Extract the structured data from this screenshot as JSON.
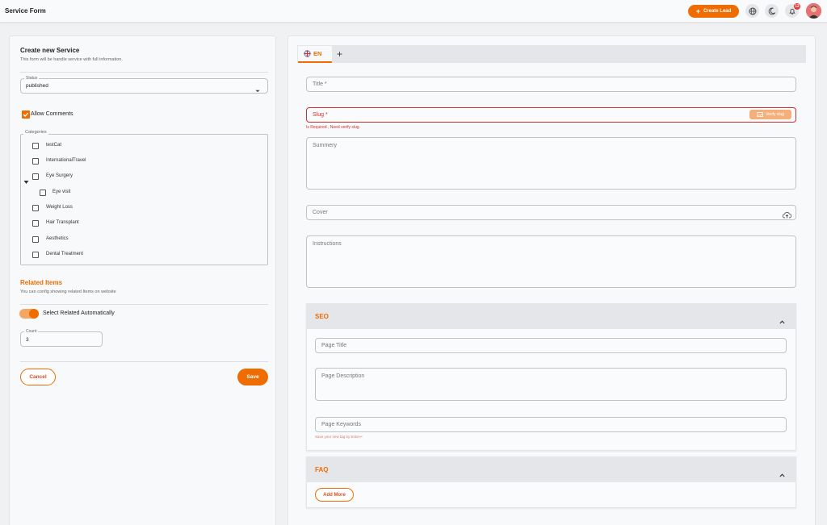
{
  "app": {
    "title": "Service Form"
  },
  "topbar": {
    "create_lead_label": "Create Lead",
    "notification_count": "12"
  },
  "left": {
    "title": "Create new Service",
    "subtitle": "This form will be handle service with full information.",
    "status": {
      "label": "Status",
      "value": "published"
    },
    "allow_comments_label": "Allow Comments",
    "categories_label": "Categories",
    "categories": [
      "testCat",
      "InternationalTravel",
      "Eye Surgery",
      "Eye visit",
      "Weight Loss",
      "Hair Transplant",
      "Aesthetics",
      "Dental Treatment"
    ],
    "related": {
      "title": "Related Items",
      "subtitle": "You can config showing related Items on website",
      "toggle_label": "Select Related Automatically",
      "count_label": "Count",
      "count_value": "3"
    },
    "cancel_label": "Cancel",
    "save_label": "Save"
  },
  "right": {
    "tab_label": "EN",
    "title_placeholder": "Title *",
    "slug_placeholder": "Slug *",
    "verify_label": "Verify slug",
    "slug_error": "Is Required , Need verify slug.",
    "summery_placeholder": "Summery",
    "cover_placeholder": "Cover",
    "instructions_placeholder": "Instructions",
    "seo": {
      "title": "SEO",
      "page_title_placeholder": "Page Title",
      "page_description_placeholder": "Page Description",
      "page_keywords_placeholder": "Page Keywords",
      "keywords_hint": "Save your new tag by Enter↵"
    },
    "faq": {
      "title": "FAQ",
      "add_more_label": "Add More"
    }
  },
  "colors": {
    "accent": "#ef6c00",
    "error": "#d32f2f"
  },
  "icons": [
    "plus-icon",
    "globe-icon",
    "moon-icon",
    "bell-icon",
    "chevron-down-icon",
    "check-icon",
    "triangle-down-icon",
    "uk-flag-icon",
    "image-icon",
    "cloud-upload-icon",
    "chevron-up-icon"
  ]
}
